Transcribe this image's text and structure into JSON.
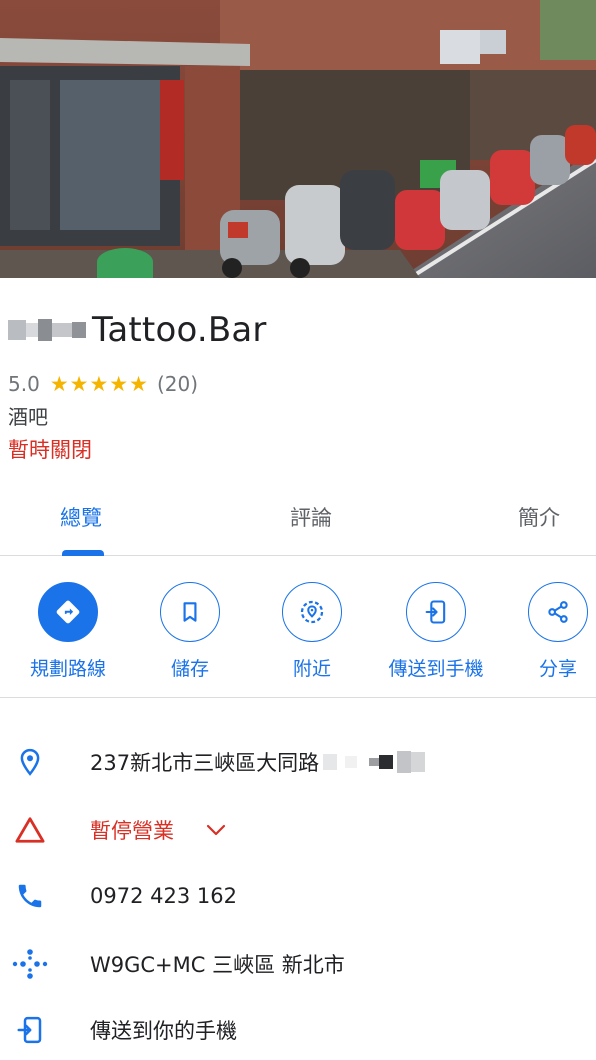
{
  "place": {
    "name": "Tattoo.Bar",
    "rating": "5.0",
    "stars": "★★★★★",
    "review_count": "(20)",
    "category": "酒吧",
    "status": "暫時關閉"
  },
  "tabs": [
    {
      "label": "總覽",
      "active": true
    },
    {
      "label": "評論",
      "active": false
    },
    {
      "label": "簡介",
      "active": false
    }
  ],
  "actions": [
    {
      "label": "規劃路線",
      "icon": "directions-icon"
    },
    {
      "label": "儲存",
      "icon": "bookmark-icon"
    },
    {
      "label": "附近",
      "icon": "nearby-icon"
    },
    {
      "label": "傳送到手機",
      "icon": "send-to-phone-icon"
    },
    {
      "label": "分享",
      "icon": "share-icon"
    }
  ],
  "info": {
    "address": "237新北市三峽區大同路",
    "hours_status": "暫停營業",
    "phone": "0972 423 162",
    "plus_code": "W9GC+MC 三峽區 新北市",
    "send_to_phone": "傳送到你的手機"
  },
  "colors": {
    "accent": "#1a73e8",
    "warning": "#d93025",
    "star": "#f5b400"
  }
}
